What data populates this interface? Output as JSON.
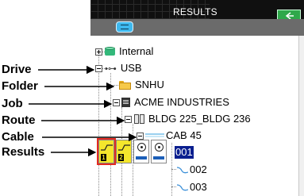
{
  "callouts": [
    "Drive",
    "Folder",
    "Job",
    "Route",
    "Cable",
    "Results"
  ],
  "panel": {
    "title": "RESULTS",
    "toolbar_icon": "list-icon",
    "exit_icon": "exit-icon"
  },
  "tree": {
    "internal": "Internal",
    "usb": "USB",
    "folder": "SNHU",
    "job": "ACME INDUSTRIES",
    "route": "BLDG 225_BLDG 236",
    "cable": "CAB 45",
    "results": [
      "001",
      "002",
      "003"
    ],
    "selected_result": "001"
  },
  "result_buttons": [
    {
      "name": "result-type-1-button",
      "number": "1",
      "color": "#f4e62c"
    },
    {
      "name": "result-type-2-button",
      "number": "2",
      "color": "#f4e62c"
    },
    {
      "name": "result-type-3-button",
      "number": "",
      "color": "#1c5fb8"
    },
    {
      "name": "result-type-4-button",
      "number": "",
      "color": "#1c5fb8"
    }
  ],
  "colors": {
    "titlebar": "#101010",
    "toolbar": "#6b6b6b",
    "selection": "#0a1f8f",
    "highlight_outline": "#e52a20"
  }
}
